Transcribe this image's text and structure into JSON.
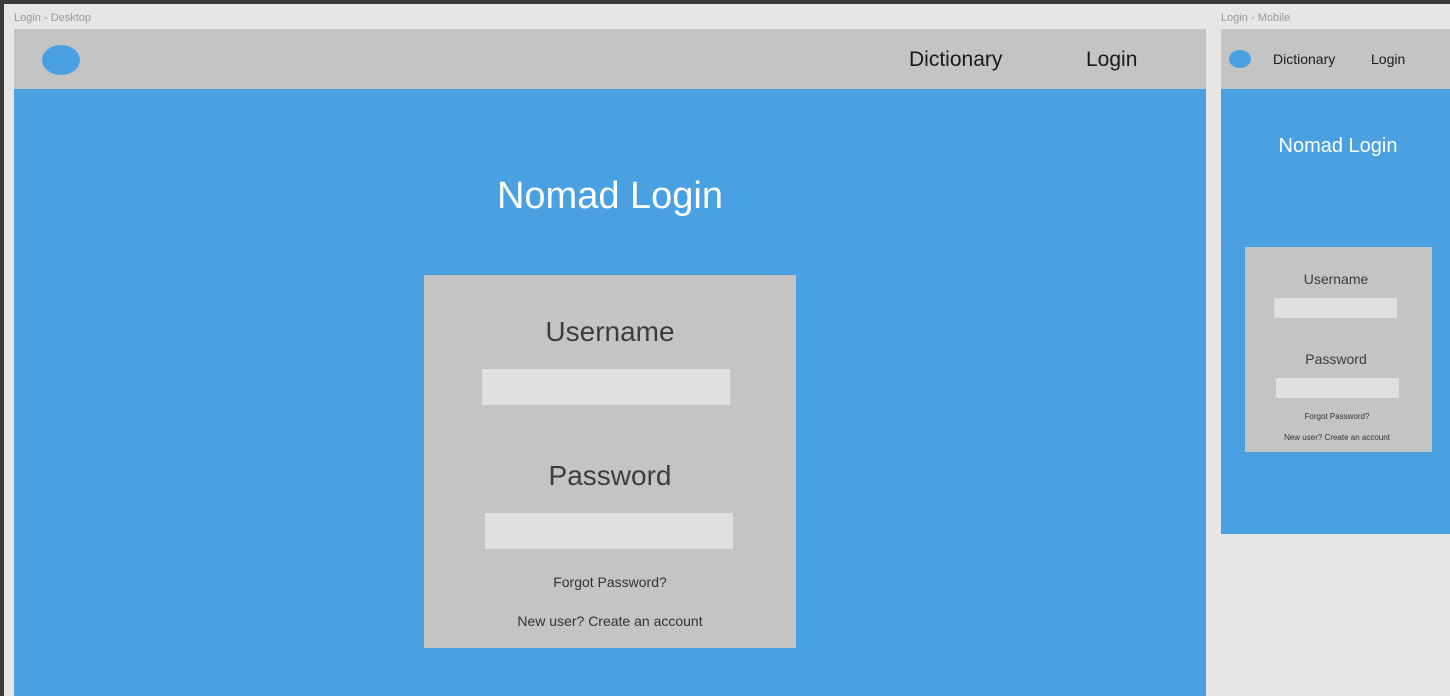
{
  "desktop": {
    "frame_label": "Login - Desktop",
    "nav": {
      "dictionary": "Dictionary",
      "login": "Login"
    },
    "title": "Nomad Login",
    "form": {
      "username_label": "Username",
      "username_value": "",
      "password_label": "Password",
      "password_value": "",
      "forgot_password": "Forgot Password?",
      "create_account": "New user? Create an account"
    }
  },
  "mobile": {
    "frame_label": "Login - Mobile",
    "nav": {
      "dictionary": "Dictionary",
      "login": "Login"
    },
    "title": "Nomad Login",
    "form": {
      "username_label": "Username",
      "username_value": "",
      "password_label": "Password",
      "password_value": "",
      "forgot_password": "Forgot Password?",
      "create_account": "New user? Create an account"
    }
  },
  "colors": {
    "background": "#e6e6e6",
    "brand_blue": "#4aa1e2",
    "panel_gray": "#c4c4c4",
    "input_gray": "#e0e0e0",
    "title_text": "#ffffff"
  },
  "icons": {
    "logo": "logo-circle-icon"
  }
}
